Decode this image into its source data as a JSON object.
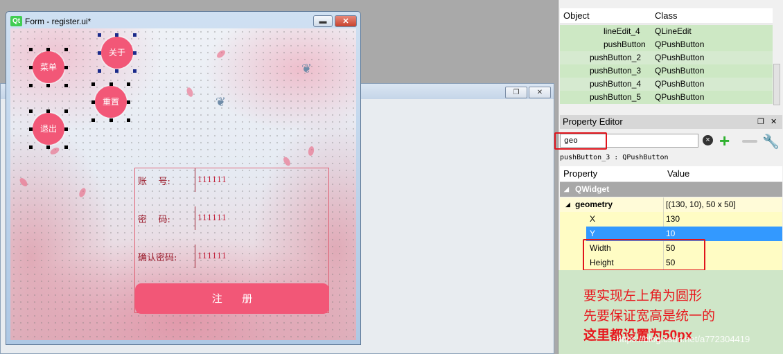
{
  "form_window": {
    "title": "Form - register.ui*",
    "qt_logo": "Qt",
    "buttons": {
      "menu": "菜单",
      "about": "关于",
      "reset": "重置",
      "exit": "退出"
    },
    "register": {
      "account_label": "账    号:",
      "account_value": "111111",
      "password_label": "密    码:",
      "password_value": "111111",
      "confirm_label": "确认密码:",
      "confirm_value": "111111",
      "register_button": "注      册"
    }
  },
  "object_inspector": {
    "headers": {
      "object": "Object",
      "class": "Class"
    },
    "rows": [
      {
        "object": "lineEdit_4",
        "class": "QLineEdit"
      },
      {
        "object": "pushButton",
        "class": "QPushButton"
      },
      {
        "object": "pushButton_2",
        "class": "QPushButton"
      },
      {
        "object": "pushButton_3",
        "class": "QPushButton"
      },
      {
        "object": "pushButton_4",
        "class": "QPushButton"
      },
      {
        "object": "pushButton_5",
        "class": "QPushButton"
      }
    ]
  },
  "property_editor": {
    "title": "Property Editor",
    "filter_value": "geo",
    "info": "pushButton_3 : QPushButton",
    "headers": {
      "property": "Property",
      "value": "Value"
    },
    "section": "QWidget",
    "geometry": {
      "name": "geometry",
      "value": "[(130, 10), 50 x 50]"
    },
    "fields": [
      {
        "name": "X",
        "value": "130"
      },
      {
        "name": "Y",
        "value": "10"
      },
      {
        "name": "Width",
        "value": "50"
      },
      {
        "name": "Height",
        "value": "50"
      }
    ]
  },
  "annotation": {
    "line1": "要实现左上角为圆形",
    "line2": "先要保证宽高是统一的",
    "line3": "这里都设置为50px",
    "watermark": "https://blog.csdn.net/a772304419"
  },
  "colors": {
    "accent_pink": "#f25777",
    "annotation_red": "#e8161c",
    "selected_row": "#3399ff"
  }
}
